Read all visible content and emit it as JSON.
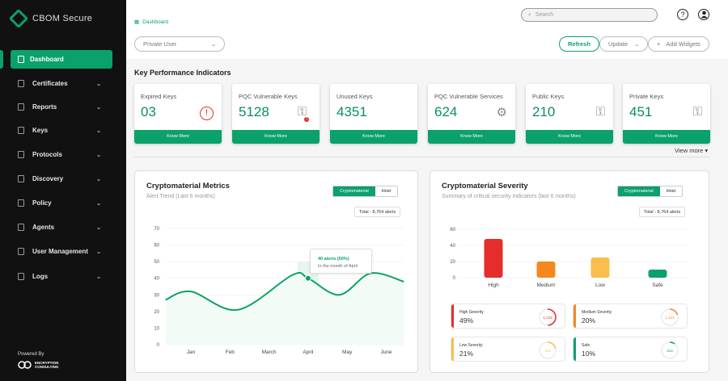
{
  "app": {
    "name": "CBOM Secure",
    "powered_by": "Powered By",
    "vendor_line1": "ENCRYPTION",
    "vendor_line2": "CONSULTING"
  },
  "sidebar": {
    "items": [
      {
        "label": "Dashboard",
        "active": true
      },
      {
        "label": "Certificates"
      },
      {
        "label": "Reports"
      },
      {
        "label": "Keys"
      },
      {
        "label": "Protocols"
      },
      {
        "label": "Discovery"
      },
      {
        "label": "Policy"
      },
      {
        "label": "Agents"
      },
      {
        "label": "User Management"
      },
      {
        "label": "Logs"
      }
    ]
  },
  "header": {
    "breadcrumb": "Dashboard",
    "search_placeholder": "Search",
    "help": "?"
  },
  "toolbar": {
    "user_select": "Private User",
    "refresh": "Refresh",
    "update": "Update",
    "add_widgets": "Add Widgets"
  },
  "kpi": {
    "title": "Key Performance Indicators",
    "view_more": "View more ▾",
    "cards": [
      {
        "label": "Expired Keys",
        "value": "03",
        "icon": "alert-icon",
        "button": "Know More"
      },
      {
        "label": "PQC Vulnerable Keys",
        "value": "5128",
        "icon": "key-alert-icon",
        "button": "Know More"
      },
      {
        "label": "Unused Keys",
        "value": "4351",
        "icon": "",
        "button": "Know More"
      },
      {
        "label": "PQC Vulnerable Services",
        "value": "624",
        "icon": "gear-icon",
        "button": "Know More"
      },
      {
        "label": "Public Keys",
        "value": "210",
        "icon": "key-icon",
        "button": "Know More"
      },
      {
        "label": "Private Keys",
        "value": "451",
        "icon": "key-icon",
        "button": "Know More"
      }
    ]
  },
  "metrics": {
    "title": "Cryptomaterial Metrics",
    "subtitle": "Alert Trend (Last 6 months)",
    "toggle": [
      "Cryptomaterial",
      "Host"
    ],
    "total": "Total - 8,764 alerts",
    "tooltip_title": "40 alerts (50%)",
    "tooltip_sub": "In the month of April"
  },
  "severity": {
    "title": "Cryptomaterial Severity",
    "subtitle": "Summary of critical security indicators (last 6 months)",
    "toggle": [
      "Cryptomaterial",
      "Host"
    ],
    "total": "Total - 8,764 alerts",
    "cards": [
      {
        "label": "High Severity",
        "percent": "49%",
        "count": "1,123",
        "fraction": 0.49,
        "color": "#e52d2d"
      },
      {
        "label": "Medium Severity",
        "percent": "20%",
        "count": "1,123",
        "fraction": 0.2,
        "color": "#f5871f"
      },
      {
        "label": "Low Severity",
        "percent": "21%",
        "count": "313",
        "fraction": 0.21,
        "color": "#fbbd4c"
      },
      {
        "label": "Safe",
        "percent": "10%",
        "count": "313",
        "fraction": 0.1,
        "color": "#0ba16a"
      }
    ]
  },
  "chart_data": [
    {
      "type": "line",
      "title": "Cryptomaterial Metrics",
      "categories": [
        "Jan",
        "Feb",
        "March",
        "April",
        "May",
        "June"
      ],
      "ylim": [
        0,
        70
      ],
      "yticks": [
        0,
        10,
        20,
        30,
        40,
        50,
        60,
        70
      ],
      "points": [
        [
          -0.65,
          27
        ],
        [
          0,
          32
        ],
        [
          1.2,
          21
        ],
        [
          2.6,
          42
        ],
        [
          3,
          40
        ],
        [
          3.8,
          30
        ],
        [
          4.6,
          43
        ],
        [
          5.45,
          38
        ]
      ],
      "highlight": "April",
      "highlight_value": 40,
      "color": "#0ba16a"
    },
    {
      "type": "bar",
      "title": "Cryptomaterial Severity",
      "categories": [
        "High",
        "Medium",
        "Low",
        "Safe"
      ],
      "values": [
        48,
        20,
        25,
        10
      ],
      "colors": [
        "#e52d2d",
        "#f5871f",
        "#fbbd4c",
        "#0ba16a"
      ],
      "ylim": [
        0,
        60
      ],
      "yticks": [
        0,
        20,
        40,
        60
      ]
    }
  ]
}
